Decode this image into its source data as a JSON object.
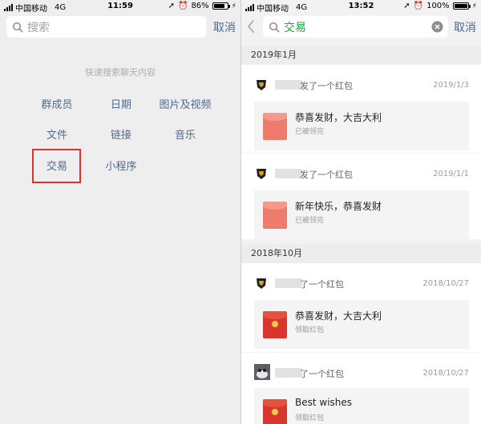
{
  "left": {
    "status": {
      "carrier": "中国移动",
      "network": "4G",
      "time": "11:59",
      "battery": "86%",
      "battery_level": 0.86
    },
    "search": {
      "placeholder": "搜索",
      "cancel": "取消"
    },
    "quick_title": "快速搜索聊天内容",
    "quick_items": [
      "群成员",
      "日期",
      "图片及视频",
      "文件",
      "链接",
      "音乐",
      "交易",
      "小程序"
    ],
    "highlighted": "交易"
  },
  "right": {
    "status": {
      "carrier": "中国移动",
      "network": "4G",
      "time": "13:52",
      "battery": "100%",
      "battery_level": 1.0
    },
    "search": {
      "query": "交易",
      "cancel": "取消"
    },
    "sections": [
      {
        "header": "2019年1月",
        "items": [
          {
            "sender_suffix": "发了一个红包",
            "date": "2019/1/3",
            "title": "恭喜发财，大吉大利",
            "status": "已被领完",
            "opened": true
          },
          {
            "sender_suffix": "发了一个红包",
            "date": "2019/1/1",
            "title": "新年快乐，恭喜发财",
            "status": "已被领完",
            "opened": true
          }
        ]
      },
      {
        "header": "2018年10月",
        "items": [
          {
            "sender_suffix": "了一个红包",
            "date": "2018/10/27",
            "title": "恭喜发财，大吉大利",
            "status": "领取红包",
            "opened": false
          },
          {
            "sender_suffix": "了一个红包",
            "date": "2018/10/27",
            "title": "Best wishes",
            "status": "领取红包",
            "opened": false
          }
        ]
      }
    ]
  },
  "colors": {
    "link_blue": "#4f6a8f",
    "cancel_blue": "#4a6a95",
    "query_green": "#15a837",
    "highlight_red": "#d9342b",
    "packet_opened": "#ee7b6c",
    "packet_unopened": "#d9352c"
  },
  "icons": [
    "search-icon",
    "back-chevron-icon",
    "clear-icon",
    "red-packet-icon",
    "avatar-icon"
  ]
}
